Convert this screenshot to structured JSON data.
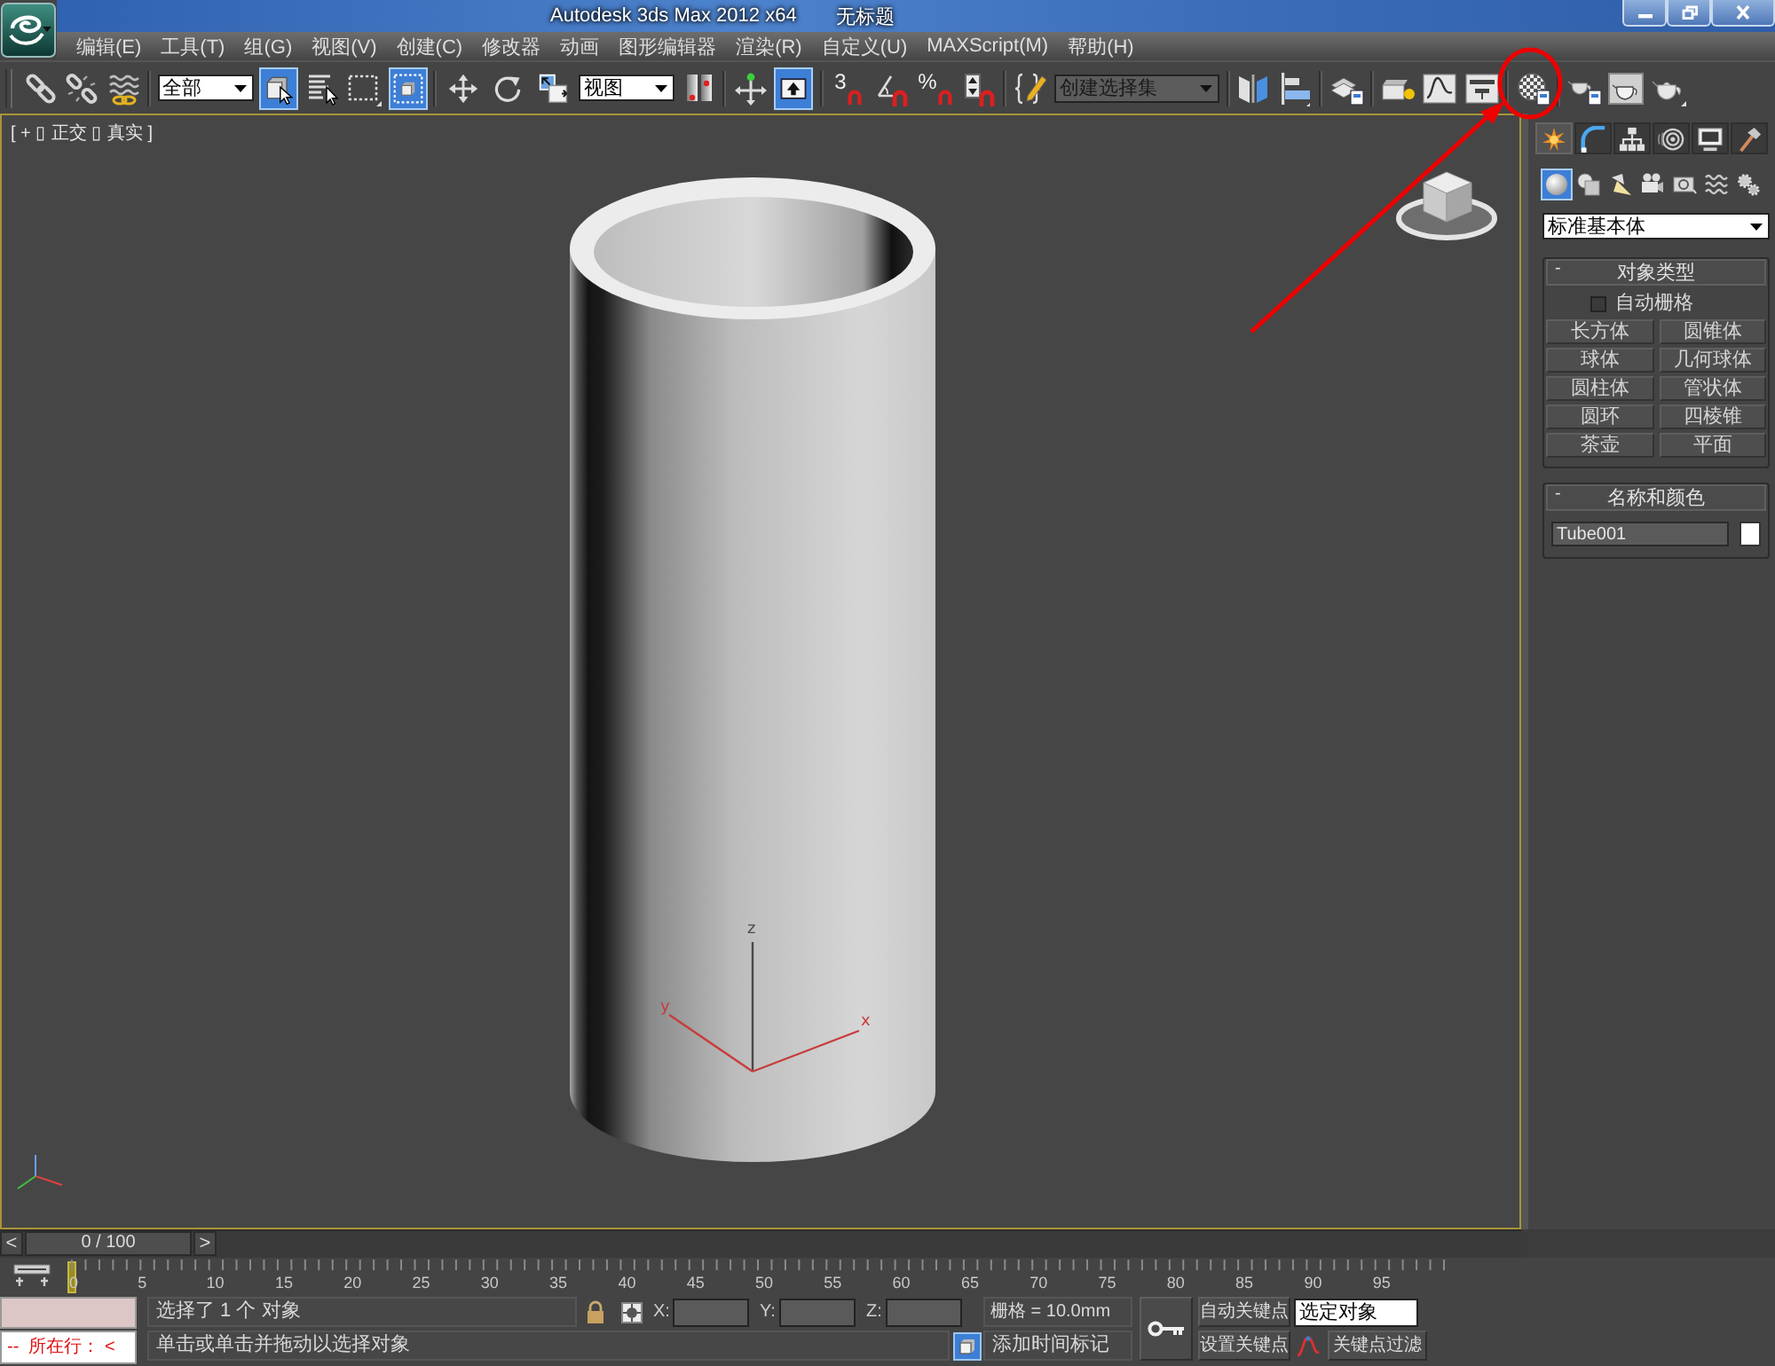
{
  "title_bar": {
    "app_title": "Autodesk 3ds Max 2012 x64",
    "document_title": "无标题"
  },
  "menu_bar": {
    "items": [
      "编辑(E)",
      "工具(T)",
      "组(G)",
      "视图(V)",
      "创建(C)",
      "修改器",
      "动画",
      "图形编辑器",
      "渲染(R)",
      "自定义(U)",
      "MAXScript(M)",
      "帮助(H)"
    ]
  },
  "toolbar": {
    "selection_filter": "全部",
    "reference_coordinate_system": "视图",
    "named_selection_set": {
      "placeholder": "创建选择集"
    },
    "snaps_toggle_label": "3",
    "percent_snap_label": "%",
    "toggles": {
      "select_object": true,
      "window_crossing": true,
      "select_and_move": false,
      "select_and_rotate": false,
      "select_and_scale": false,
      "keyboard_shortcut_override": true
    }
  },
  "viewport": {
    "label": "[ + ▯ 正交 ▯ 真实 ]",
    "active": true,
    "gizmo_axes": [
      {
        "label": "z",
        "color": "#4a4a4a"
      },
      {
        "label": "y",
        "color": "#c83c3c"
      },
      {
        "label": "x",
        "color": "#c83c3c"
      }
    ]
  },
  "command_panel": {
    "tabs": [
      {
        "selected": true
      },
      {
        "selected": false
      },
      {
        "selected": false
      },
      {
        "selected": false
      },
      {
        "selected": false
      },
      {
        "selected": false
      }
    ],
    "categories": [
      {
        "selected": true
      },
      {
        "selected": false
      },
      {
        "selected": false
      },
      {
        "selected": false
      },
      {
        "selected": false
      },
      {
        "selected": false
      },
      {
        "selected": false
      }
    ],
    "category_dropdown": "标准基本体",
    "object_type": {
      "title": "对象类型",
      "toggle": "-",
      "auto_grid": {
        "label": "自动栅格",
        "checked": false
      },
      "buttons": [
        "长方体",
        "圆锥体",
        "球体",
        "几何球体",
        "圆柱体",
        "管状体",
        "圆环",
        "四棱锥",
        "茶壶",
        "平面"
      ]
    },
    "name_and_color": {
      "title": "名称和颜色",
      "toggle": "-",
      "name": "Tube001",
      "color": "#ffffff"
    }
  },
  "time_slider": {
    "prev": "<",
    "label": "0 / 100",
    "next": ">",
    "level": 0
  },
  "track_bar": {
    "frame_labels": [
      "0",
      "5",
      "10",
      "15",
      "20",
      "25",
      "30",
      "35",
      "40",
      "45",
      "50",
      "55",
      "60",
      "65",
      "70",
      "75",
      "80",
      "85",
      "90",
      "95"
    ]
  },
  "status_bar": {
    "listener": "--  所在行： <",
    "selection_info": "选择了 1 个 对象",
    "coordinates": [
      "X:",
      "Y:",
      "Z:"
    ],
    "grid": "栅格 = 10.0mm",
    "prompt": "单击或单击并拖动以选择对象",
    "add_time_tag": "添加时间标记",
    "auto_key": {
      "label": "自动关键点",
      "on": false
    },
    "key_mode": "选定对象",
    "set_key": "设置关键点",
    "key_filters": "关键点过滤"
  }
}
